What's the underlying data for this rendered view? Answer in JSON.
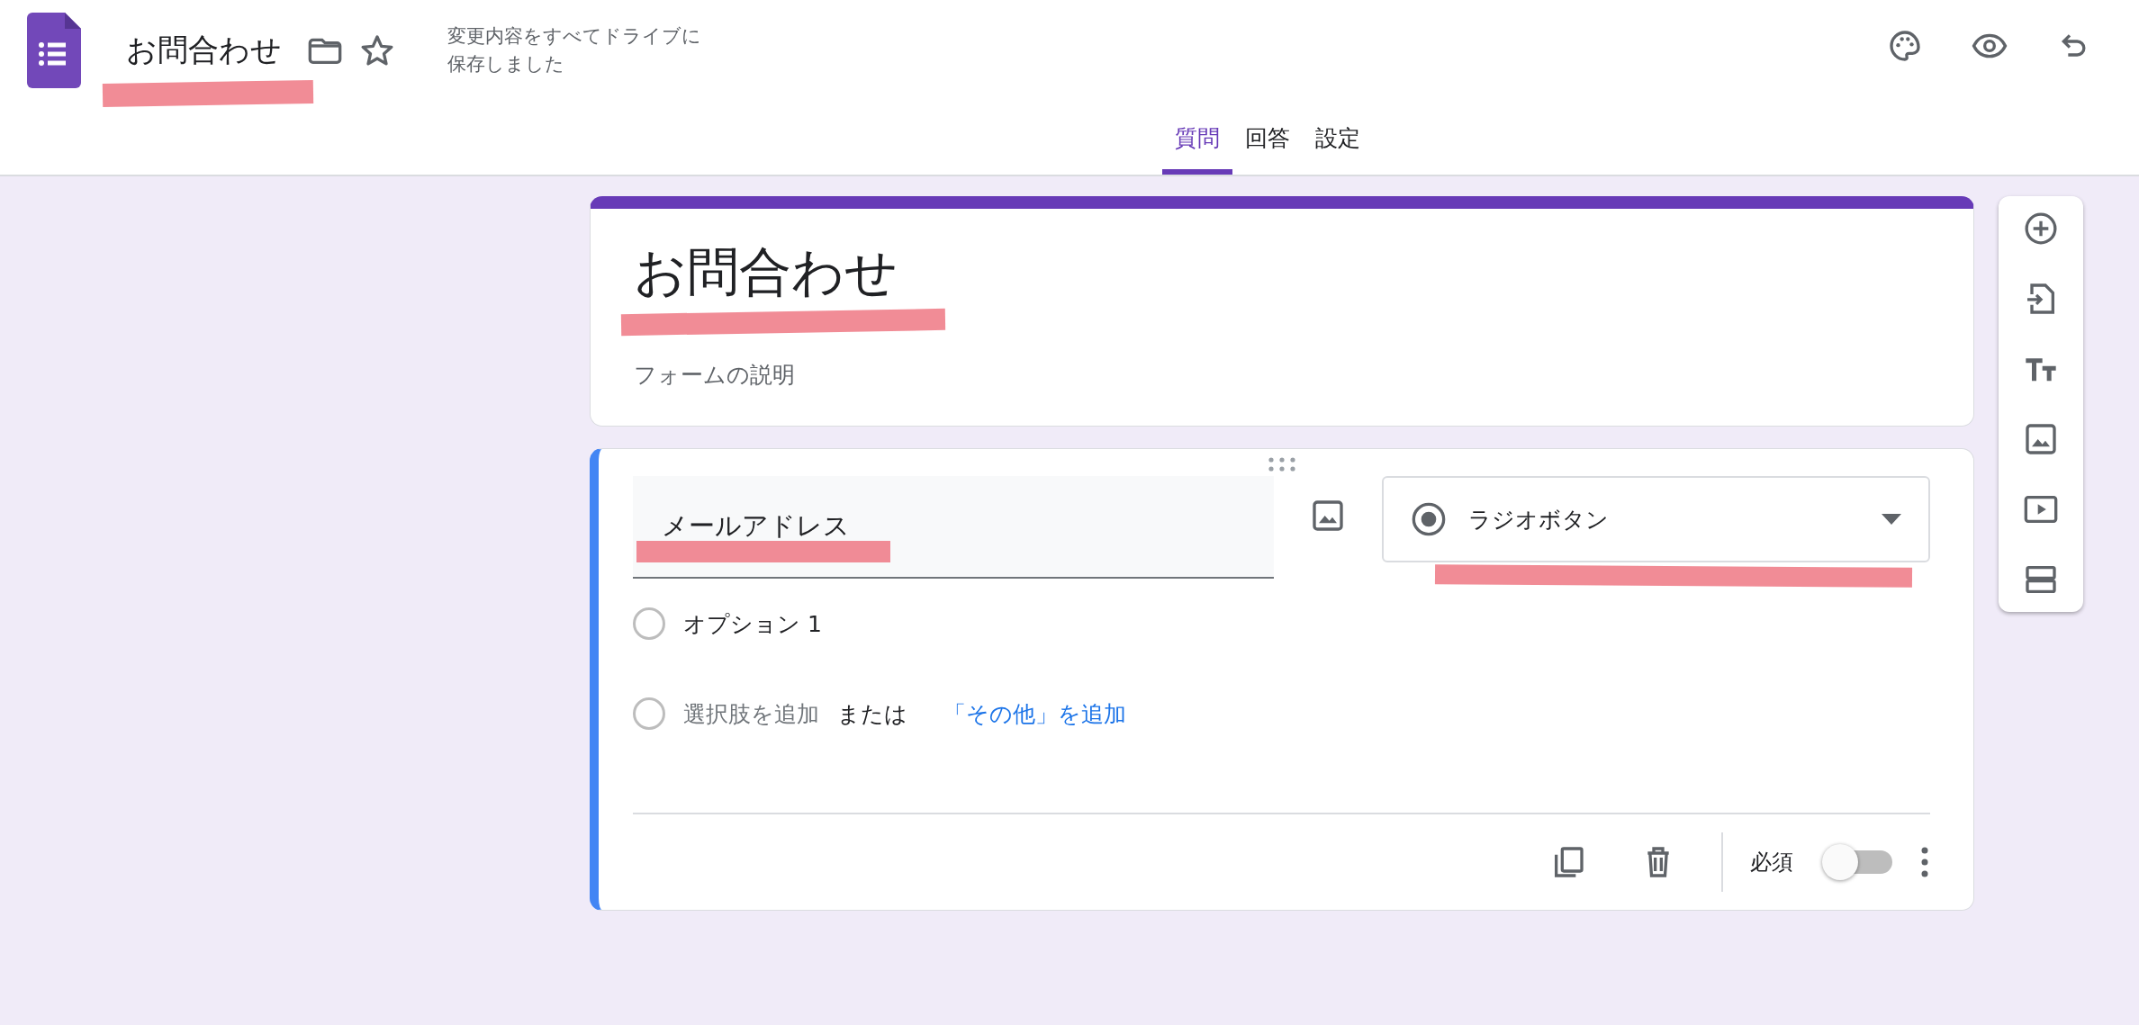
{
  "header": {
    "title": "お問合わせ",
    "save_status": "変更内容をすべてドライブに保存しました"
  },
  "tabs": [
    {
      "label": "質問",
      "selected": true
    },
    {
      "label": "回答",
      "selected": false
    },
    {
      "label": "設定",
      "selected": false
    }
  ],
  "form": {
    "title": "お問合わせ",
    "description": {
      "placeholder": "フォームの説明"
    }
  },
  "question": {
    "title": "メールアドレス",
    "type": "ラジオボタン",
    "options": [
      {
        "label": "オプション 1"
      }
    ],
    "add_option": "選択肢を追加",
    "or": "または",
    "add_other": "「その他」を追加",
    "required_label": "必須",
    "required": false
  }
}
